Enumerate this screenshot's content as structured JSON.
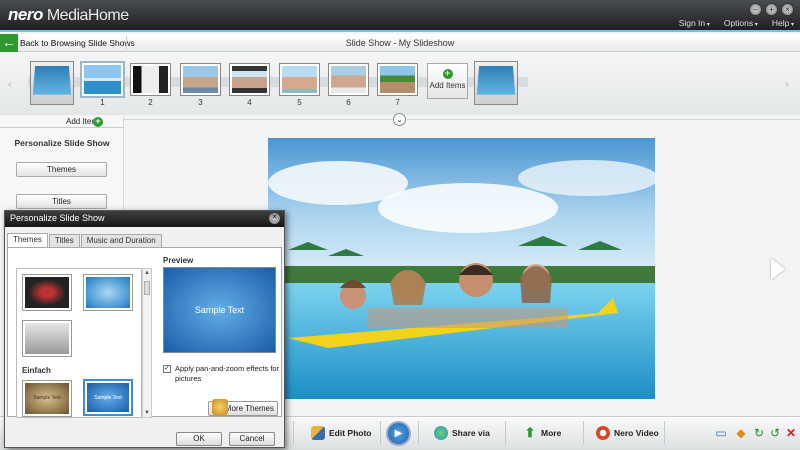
{
  "app": {
    "brand": "nero",
    "title": "MediaHome"
  },
  "window_buttons": [
    "–",
    "+",
    "×"
  ],
  "menu": [
    "Sign In",
    "Options",
    "Help"
  ],
  "nav": {
    "back_label": "Back to Browsing Slide Shows",
    "page_title": "Slide Show - My Slideshow"
  },
  "strip": {
    "slide_numbers": [
      "1",
      "2",
      "3",
      "4",
      "5",
      "6",
      "7"
    ],
    "add_items_label": "Add Items"
  },
  "sidebar": {
    "add_items_label": "Add Items",
    "heading": "Personalize Slide Show",
    "buttons": [
      "Themes",
      "Titles"
    ]
  },
  "bottombar": {
    "edit_photo": "Edit Photo",
    "share_via": "Share via",
    "more": "More",
    "nero_video": "Nero Video"
  },
  "dialog": {
    "title": "Personalize Slide Show",
    "tabs": [
      "Themes",
      "Titles",
      "Music and Duration"
    ],
    "group_label": "Einfach",
    "preview_label": "Preview",
    "preview_text": "Sample Text",
    "checkbox_checked": true,
    "checkbox_label": "Apply pan-and-zoom effects for pictures",
    "more_themes": "More Themes",
    "ok": "OK",
    "cancel": "Cancel",
    "thumb_texts": [
      "Sample Text",
      "Sample Text"
    ]
  },
  "colors": {
    "accent": "#6ec7e0",
    "back_green": "#2d9a2d",
    "theme_blue": "#1b5ca8"
  },
  "icons": [
    "back-arrow-icon",
    "add-icon",
    "chevron-down-icon",
    "play-icon",
    "edit-photo-icon",
    "share-icon",
    "more-arrow-icon",
    "nero-video-icon",
    "monitor-icon",
    "burn-icon",
    "refresh-icon",
    "undo-icon",
    "close-icon",
    "next-arrow-icon"
  ]
}
